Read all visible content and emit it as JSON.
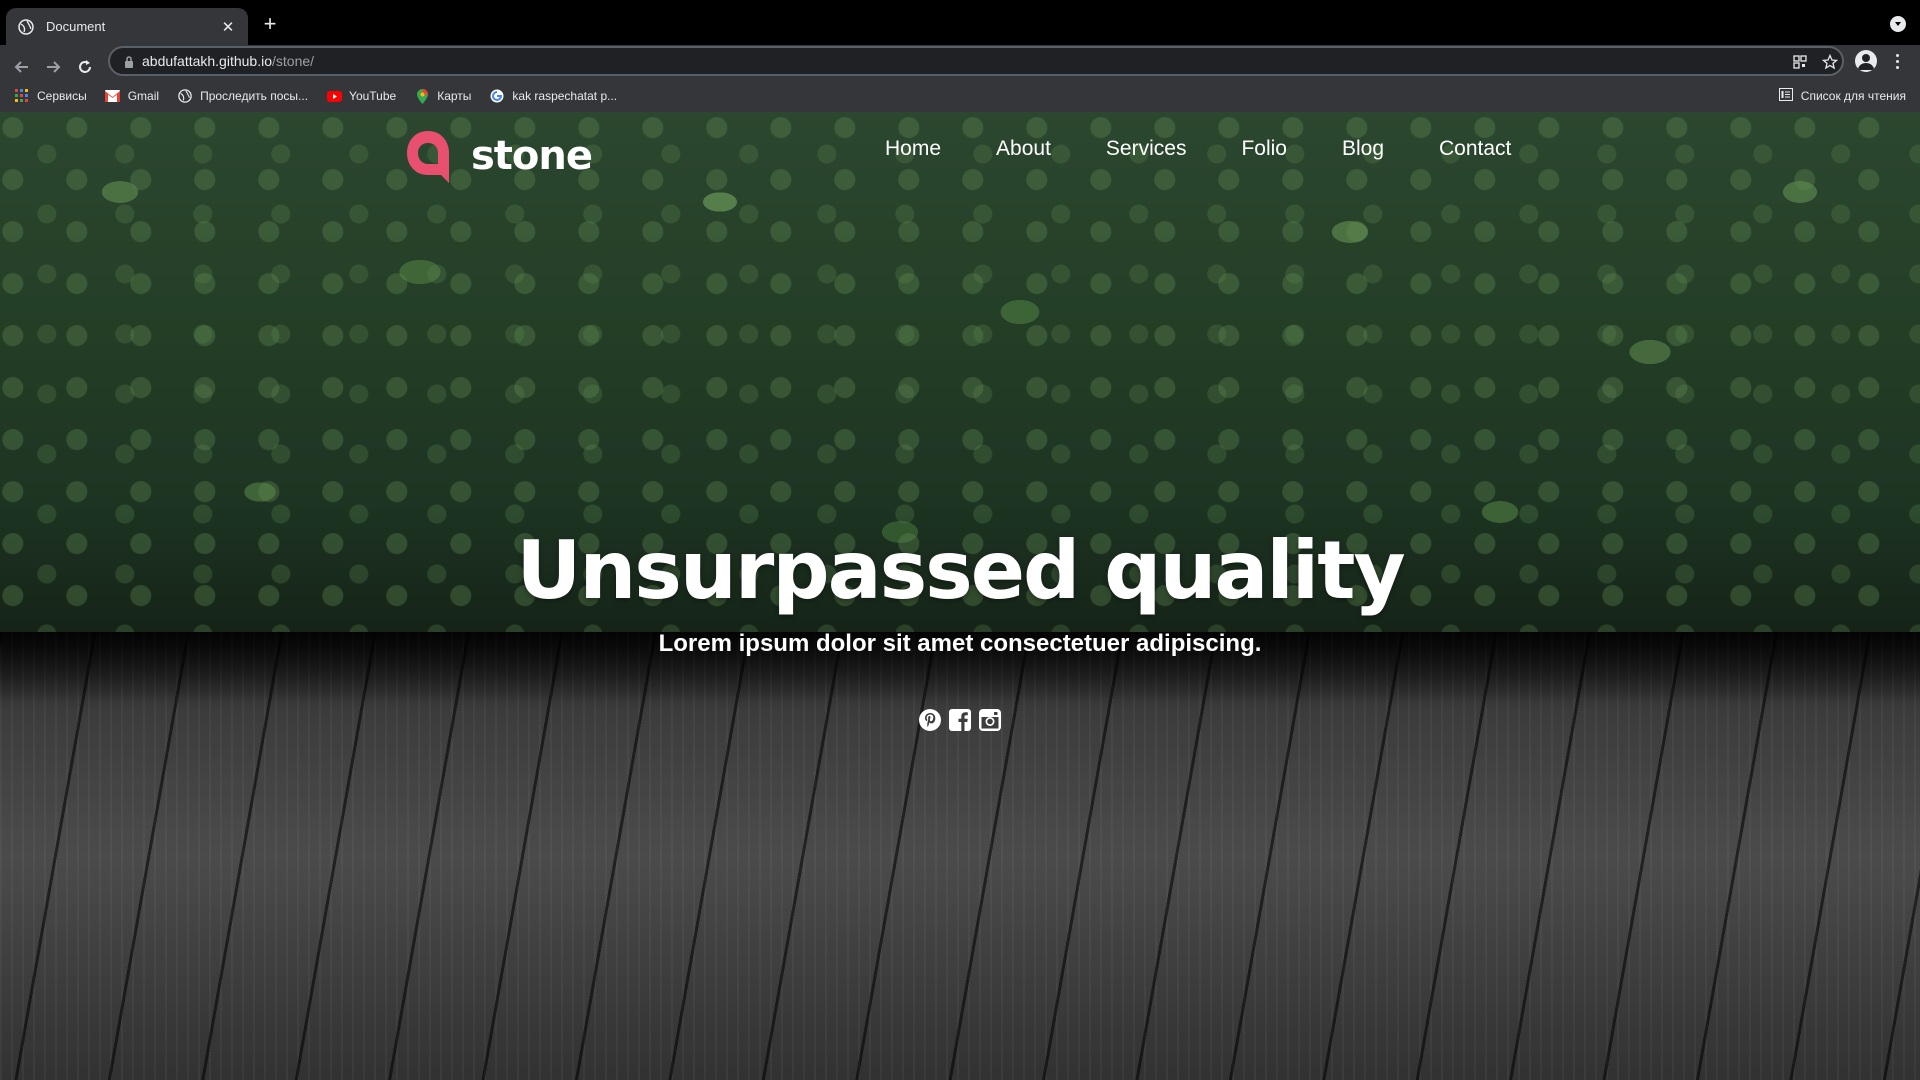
{
  "browser": {
    "tab_title": "Document",
    "address_host": "abdufattakh.github.io",
    "address_path": "/stone/",
    "bookmarks": [
      {
        "label": "Сервисы",
        "icon": "apps-grid-icon"
      },
      {
        "label": "Gmail",
        "icon": "gmail-icon"
      },
      {
        "label": "Проследить посы...",
        "icon": "globe-icon"
      },
      {
        "label": "YouTube",
        "icon": "youtube-icon"
      },
      {
        "label": "Карты",
        "icon": "maps-pin-icon"
      },
      {
        "label": "kak raspechatat p...",
        "icon": "google-icon"
      }
    ],
    "reading_list_label": "Список для чтения"
  },
  "site": {
    "logo_text": "stone",
    "accent_color": "#e94f6f",
    "nav": [
      {
        "label": "Home"
      },
      {
        "label": "About"
      },
      {
        "label": "Services"
      },
      {
        "label": "Folio"
      },
      {
        "label": "Blog"
      },
      {
        "label": "Contact"
      }
    ],
    "hero": {
      "headline": "Unsurpassed quality",
      "subline": "Lorem ipsum dolor sit amet consectetuer adipiscing."
    },
    "social": [
      {
        "icon": "pinterest-icon"
      },
      {
        "icon": "facebook-icon"
      },
      {
        "icon": "instagram-icon"
      }
    ]
  }
}
